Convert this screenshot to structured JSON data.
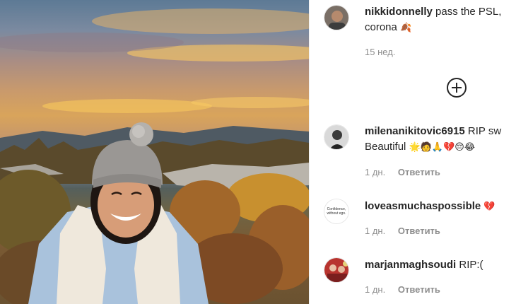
{
  "post": {
    "photo_label": "photo-post-image"
  },
  "comments": [
    {
      "username": "nikkidonnelly",
      "text": "pass the PSL,",
      "text_line2": "corona",
      "emoji": "🍂",
      "time": "15 нед.",
      "reply_label": "",
      "avatar_icon": "user-avatar-photo"
    },
    {
      "username": "milenanikitovic6915",
      "text": "RIP sw",
      "text_line2": "Beautiful",
      "emoji": "🌟🧑🙏💔😔😂",
      "time": "1 дн.",
      "reply_label": "Ответить",
      "avatar_icon": "user-avatar-photo"
    },
    {
      "username": "loveasmuchaspossible",
      "text": "",
      "emoji": "💔",
      "time": "1 дн.",
      "reply_label": "Ответить",
      "avatar_text": "Confidence, without ego.",
      "avatar_icon": "text-logo-avatar"
    },
    {
      "username": "marjanmaghsoudi",
      "text": "RIP:(",
      "time": "1 дн.",
      "reply_label": "Ответить",
      "avatar_icon": "user-avatar-photo"
    }
  ],
  "load_more": {
    "icon": "plus-circle-icon"
  },
  "colors": {
    "text": "#262626",
    "muted": "#8e8e8e"
  }
}
